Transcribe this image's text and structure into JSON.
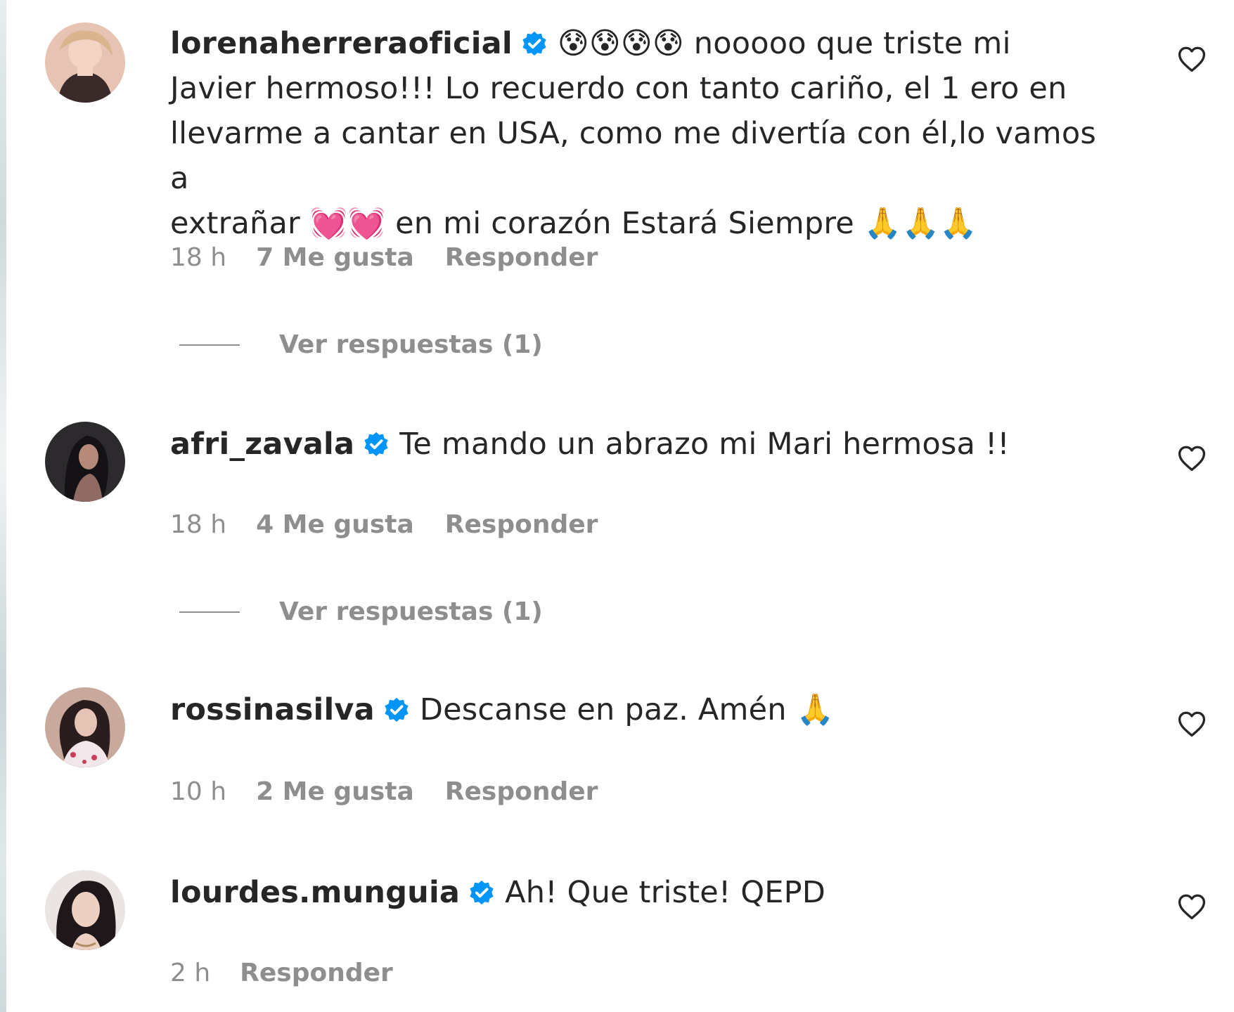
{
  "comments": [
    {
      "username": "lorenaherreraoficial",
      "text_start": "😰😰😰😰 nooooo que triste mi",
      "text_line2": "Javier hermoso!!! Lo recuerdo con tanto cariño, el 1 ero en",
      "text_line3": "llevarme a cantar en USA, como me divertía con él,lo vamos a",
      "text_line4": "extrañar 💓💓 en mi corazón Estará Siempre 🙏🙏🙏",
      "time": "18 h",
      "likes": "7 Me gusta",
      "reply": "Responder",
      "view_replies": "Ver respuestas (1)"
    },
    {
      "username": "afri_zavala",
      "text": "Te mando un abrazo mi Mari hermosa !!",
      "time": "18 h",
      "likes": "4 Me gusta",
      "reply": "Responder",
      "view_replies": "Ver respuestas (1)"
    },
    {
      "username": "rossinasilva",
      "text": "Descanse en paz. Amén 🙏",
      "time": "10 h",
      "likes": "2 Me gusta",
      "reply": "Responder"
    },
    {
      "username": "lourdes.munguia",
      "text": "Ah! Que triste! QEPD",
      "time": "2 h",
      "reply": "Responder"
    }
  ],
  "colors": {
    "text": "#262626",
    "secondary": "#8e8e8e",
    "verified": "#0095f6"
  },
  "icons": {
    "verified": "verified-badge-icon",
    "like": "heart-outline-icon"
  }
}
